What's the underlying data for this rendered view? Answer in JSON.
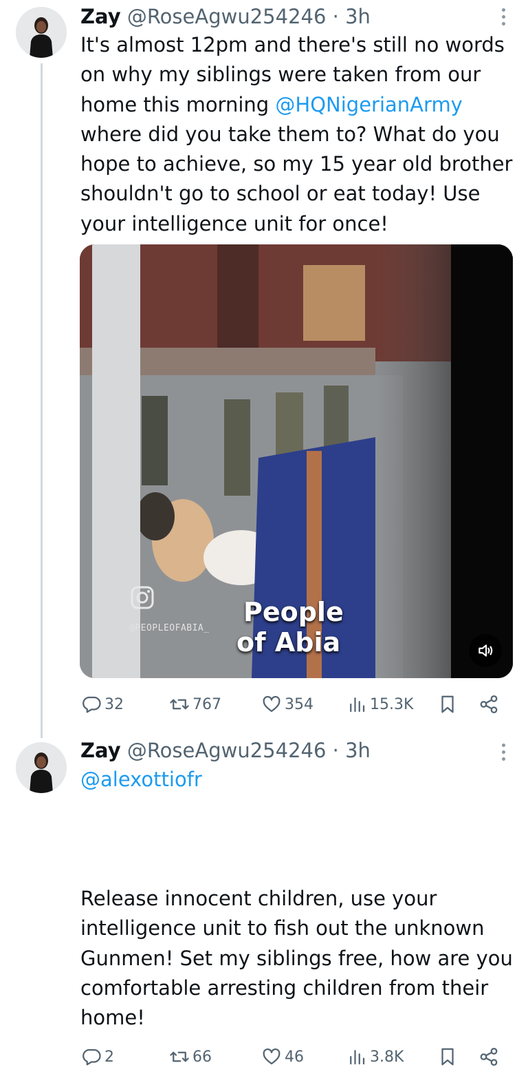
{
  "colors": {
    "text": "#0f1419",
    "secondary": "#536471",
    "link": "#1d9bf0",
    "thread_line": "#cfd9de"
  },
  "tweets": [
    {
      "name": "Zay",
      "handle": "@RoseAgwu254246",
      "separator": "·",
      "time": "3h",
      "text_parts": {
        "before": "It's almost 12pm and there's still no words on why my siblings were taken from our home this morning ",
        "mention": "@HQNigerianArmy",
        "after": " where did you take them to? What do you hope to achieve, so my 15 year old brother shouldn't go to school or eat today! Use your intelligence unit for once!"
      },
      "media": {
        "watermark_handle": "@PEOPLEOFABIA_",
        "caption_line1": "People",
        "caption_line2": "of Abia",
        "icons": [
          "instagram-icon",
          "volume-icon"
        ]
      },
      "stats": {
        "replies": "32",
        "reposts": "767",
        "likes": "354",
        "views": "15.3K"
      }
    },
    {
      "name": "Zay",
      "handle": "@RoseAgwu254246",
      "separator": "·",
      "time": "3h",
      "mention": "@alexottiofr",
      "text": "Release innocent children, use your intelligence unit to fish out the unknown Gunmen! Set my siblings free, how are you comfortable arresting children from their home!",
      "stats": {
        "replies": "2",
        "reposts": "66",
        "likes": "46",
        "views": "3.8K"
      }
    }
  ],
  "icons": [
    "reply-icon",
    "repost-icon",
    "like-icon",
    "views-icon",
    "bookmark-icon",
    "share-icon",
    "more-icon"
  ]
}
